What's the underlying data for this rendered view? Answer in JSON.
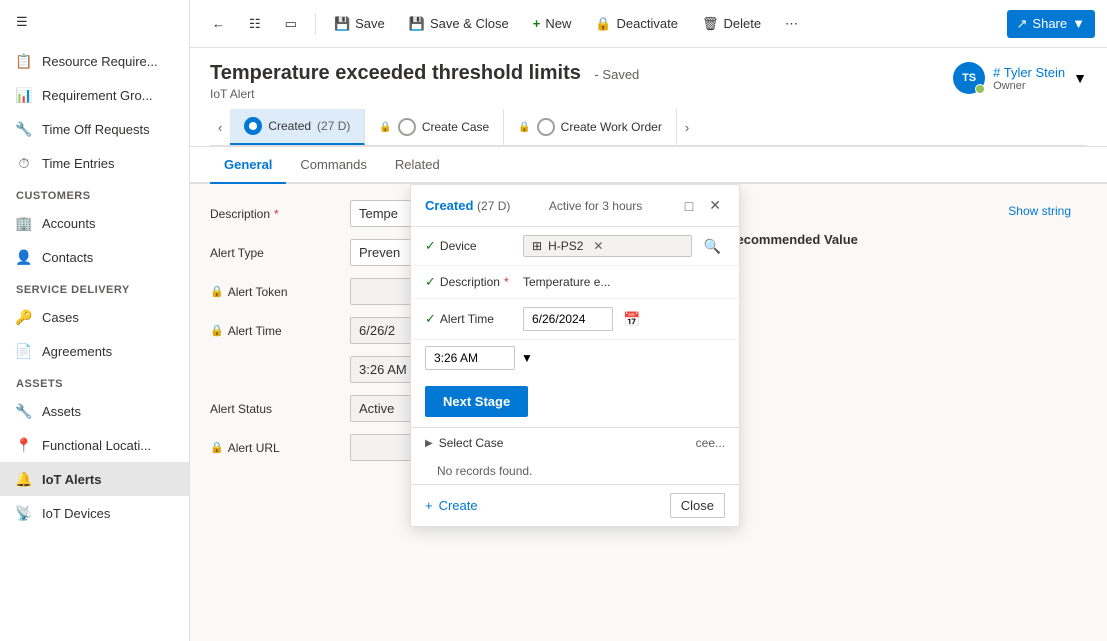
{
  "sidebar": {
    "hamburger_icon": "☰",
    "sections": [
      {
        "items": [
          {
            "id": "resource-req",
            "label": "Resource Require...",
            "icon": "📋"
          },
          {
            "id": "requirement-grp",
            "label": "Requirement Gro...",
            "icon": "📊"
          },
          {
            "id": "time-off",
            "label": "Time Off Requests",
            "icon": "🔧"
          },
          {
            "id": "time-entries",
            "label": "Time Entries",
            "icon": "⏱"
          }
        ]
      },
      {
        "section_label": "Customers",
        "items": [
          {
            "id": "accounts",
            "label": "Accounts",
            "icon": "🏢"
          },
          {
            "id": "contacts",
            "label": "Contacts",
            "icon": "👤"
          }
        ]
      },
      {
        "section_label": "Service Delivery",
        "items": [
          {
            "id": "cases",
            "label": "Cases",
            "icon": "🔑"
          },
          {
            "id": "agreements",
            "label": "Agreements",
            "icon": "📄"
          }
        ]
      },
      {
        "section_label": "Assets",
        "items": [
          {
            "id": "assets",
            "label": "Assets",
            "icon": "🔧"
          },
          {
            "id": "functional-loc",
            "label": "Functional Locati...",
            "icon": "📍"
          },
          {
            "id": "iot-alerts",
            "label": "IoT Alerts",
            "icon": "🔔",
            "active": true
          },
          {
            "id": "iot-devices",
            "label": "IoT Devices",
            "icon": "📡"
          }
        ]
      }
    ]
  },
  "commandbar": {
    "back_label": "←",
    "toggle_icon": "⊞",
    "split_icon": "⊟",
    "save_label": "Save",
    "save_close_label": "Save & Close",
    "new_label": "New",
    "deactivate_label": "Deactivate",
    "delete_label": "Delete",
    "more_icon": "⋯",
    "share_label": "Share"
  },
  "record": {
    "title": "Temperature exceeded threshold limits",
    "saved_indicator": "- Saved",
    "subtitle": "IoT Alert",
    "owner_initials": "TS",
    "owner_name": "# Tyler Stein",
    "owner_label": "Owner"
  },
  "process_bar": {
    "stages": [
      {
        "id": "created",
        "label": "Created",
        "sub": "(27 D)",
        "active": true,
        "locked": false
      },
      {
        "id": "create-case",
        "label": "Create Case",
        "active": false,
        "locked": true
      },
      {
        "id": "create-work-order",
        "label": "Create Work Order",
        "active": false,
        "locked": true
      }
    ],
    "active_stage_detail": "Active for 3 hours"
  },
  "tabs": [
    {
      "id": "general",
      "label": "General",
      "active": true
    },
    {
      "id": "commands",
      "label": "Commands",
      "active": false
    },
    {
      "id": "related",
      "label": "Related",
      "active": false
    }
  ],
  "form": {
    "description_label": "Description",
    "description_value": "Tempe",
    "alert_type_label": "Alert Type",
    "alert_type_value": "Preven",
    "alert_token_label": "Alert Token",
    "alert_token_value": "",
    "alert_time_label": "Alert Time",
    "alert_time_value": "6/26/2",
    "alert_time_hm": "3:26 AM",
    "alert_status_label": "Alert Status",
    "alert_status_value": "Active",
    "alert_url_label": "Alert URL",
    "alert_url_value": "",
    "show_string_label": "Show string",
    "exceeding_label": "Exceeding Recommended Value"
  },
  "side_panel": {
    "title": "Created",
    "sub_title": "(27 D)",
    "detail_text": "Active for 3 hours",
    "device_label": "Device",
    "device_value": "H-PS2",
    "description_label": "Description",
    "description_value": "Temperature e...",
    "alert_time_label": "Alert Time",
    "alert_time_date": "6/26/2024",
    "alert_time_hm": "3:26 AM",
    "next_stage_label": "Next Stage",
    "select_case_label": "Select Case",
    "no_records_label": "No records found.",
    "create_label": "+ Create",
    "close_label": "Close",
    "arrow_icon": "▶"
  }
}
